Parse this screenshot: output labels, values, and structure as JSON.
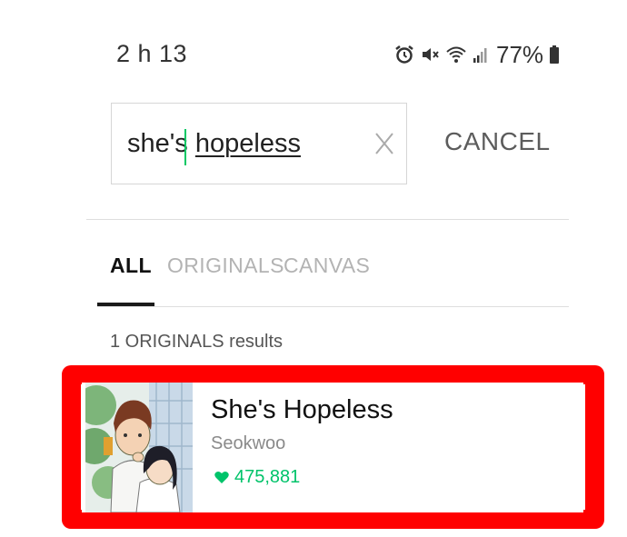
{
  "status_bar": {
    "time": "2 h 13",
    "battery": "77%",
    "icons": [
      "alarm-icon",
      "mute-icon",
      "wifi-icon",
      "signal-icon",
      "battery-icon"
    ]
  },
  "search": {
    "query_plain": "she's ",
    "query_underlined": "hopeless",
    "cancel_label": "CANCEL"
  },
  "tabs": [
    {
      "label": "ALL",
      "selected": true
    },
    {
      "label": "ORIGINALS",
      "selected": false
    },
    {
      "label": "CANVAS",
      "selected": false
    }
  ],
  "results": {
    "count_label": "1 ORIGINALS results",
    "items": [
      {
        "title": "She's Hopeless",
        "author": "Seokwoo",
        "likes": "475,881"
      }
    ]
  },
  "colors": {
    "accent_green": "#00c36a",
    "highlight_red": "#ff0000"
  }
}
